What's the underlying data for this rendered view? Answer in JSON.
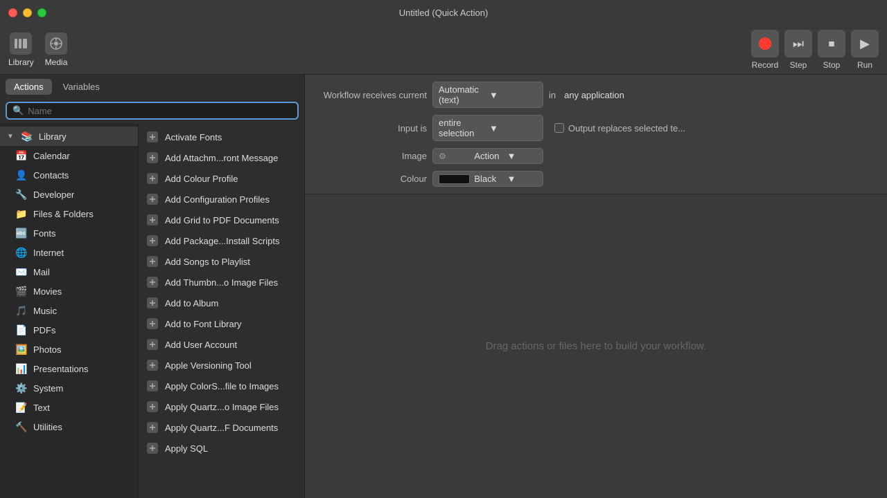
{
  "window": {
    "title": "Untitled (Quick Action)"
  },
  "toolbar": {
    "library_label": "Library",
    "media_label": "Media",
    "record_label": "Record",
    "step_label": "Step",
    "stop_label": "Stop",
    "run_label": "Run"
  },
  "tabs": {
    "actions_label": "Actions",
    "variables_label": "Variables"
  },
  "search": {
    "placeholder": "Name"
  },
  "categories": [
    {
      "id": "library",
      "label": "Library",
      "icon": "📚",
      "expanded": true,
      "indent": 0
    },
    {
      "id": "calendar",
      "label": "Calendar",
      "icon": "📅",
      "indent": 1
    },
    {
      "id": "contacts",
      "label": "Contacts",
      "icon": "👤",
      "indent": 1
    },
    {
      "id": "developer",
      "label": "Developer",
      "icon": "🔧",
      "indent": 1
    },
    {
      "id": "files-folders",
      "label": "Files & Folders",
      "icon": "📁",
      "indent": 1
    },
    {
      "id": "fonts",
      "label": "Fonts",
      "icon": "🔤",
      "indent": 1
    },
    {
      "id": "internet",
      "label": "Internet",
      "icon": "🌐",
      "indent": 1
    },
    {
      "id": "mail",
      "label": "Mail",
      "icon": "✉️",
      "indent": 1
    },
    {
      "id": "movies",
      "label": "Movies",
      "icon": "🎬",
      "indent": 1
    },
    {
      "id": "music",
      "label": "Music",
      "icon": "🎵",
      "indent": 1
    },
    {
      "id": "pdfs",
      "label": "PDFs",
      "icon": "📄",
      "indent": 1
    },
    {
      "id": "photos",
      "label": "Photos",
      "icon": "🖼️",
      "indent": 1
    },
    {
      "id": "presentations",
      "label": "Presentations",
      "icon": "📊",
      "indent": 1
    },
    {
      "id": "system",
      "label": "System",
      "icon": "⚙️",
      "indent": 1
    },
    {
      "id": "text",
      "label": "Text",
      "icon": "📝",
      "indent": 1
    },
    {
      "id": "utilities",
      "label": "Utilities",
      "icon": "🔨",
      "indent": 1
    }
  ],
  "actions": [
    {
      "id": "activate-fonts",
      "label": "Activate Fonts",
      "icon": "⚙️"
    },
    {
      "id": "add-attachment",
      "label": "Add Attachm...ront Message",
      "icon": "⚙️"
    },
    {
      "id": "add-colour-profile",
      "label": "Add Colour Profile",
      "icon": "⚙️"
    },
    {
      "id": "add-configuration-profiles",
      "label": "Add Configuration Profiles",
      "icon": "⚙️"
    },
    {
      "id": "add-grid-pdf",
      "label": "Add Grid to PDF Documents",
      "icon": "⚙️"
    },
    {
      "id": "add-package-scripts",
      "label": "Add Package...Install Scripts",
      "icon": "⚙️"
    },
    {
      "id": "add-songs-playlist",
      "label": "Add Songs to Playlist",
      "icon": "⚙️"
    },
    {
      "id": "add-thumbnail",
      "label": "Add Thumbn...o Image Files",
      "icon": "⚙️"
    },
    {
      "id": "add-to-album",
      "label": "Add to Album",
      "icon": "⚙️"
    },
    {
      "id": "add-to-font-library",
      "label": "Add to Font Library",
      "icon": "⚙️"
    },
    {
      "id": "add-user-account",
      "label": "Add User Account",
      "icon": "⚙️"
    },
    {
      "id": "apple-versioning",
      "label": "Apple Versioning Tool",
      "icon": "⚙️"
    },
    {
      "id": "apply-colors-images",
      "label": "Apply ColorS...file to Images",
      "icon": "⚙️"
    },
    {
      "id": "apply-quartz-image",
      "label": "Apply Quartz...o Image Files",
      "icon": "⚙️"
    },
    {
      "id": "apply-quartz-docs",
      "label": "Apply Quartz...F Documents",
      "icon": "⚙️"
    },
    {
      "id": "apply-sql",
      "label": "Apply SQL",
      "icon": "⚙️"
    }
  ],
  "workflow": {
    "receives_label": "Workflow receives current",
    "receives_value": "Automatic (text)",
    "in_label": "in",
    "in_value": "any application",
    "input_is_label": "Input is",
    "input_is_value": "entire selection",
    "output_replaces_label": "Output replaces selected te...",
    "image_label": "Image",
    "image_value": "Action",
    "colour_label": "Colour",
    "colour_value": "Black",
    "drag_hint": "Drag actions or files here to build your workflow."
  }
}
